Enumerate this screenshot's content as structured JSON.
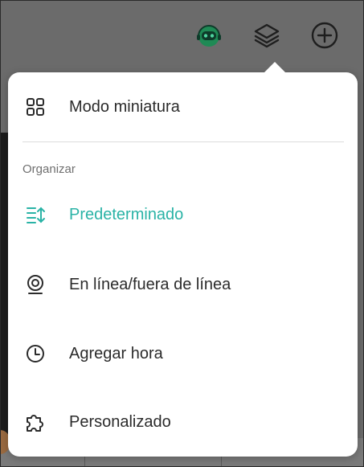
{
  "colors": {
    "accent": "#2ab3a6",
    "text": "#2b2b2b",
    "muted": "#6f6f6f",
    "robot_green": "#1f8a55"
  },
  "toolbar": {
    "icons": [
      "assistant-robot-icon",
      "layers-icon",
      "add-circle-icon"
    ]
  },
  "menu": {
    "thumbnail_mode": {
      "label": "Modo miniatura",
      "icon": "grid-icon"
    },
    "section_label": "Organizar",
    "items": [
      {
        "label": "Predeterminado",
        "icon": "sort-icon",
        "selected": true
      },
      {
        "label": "En línea/fuera de línea",
        "icon": "online-status-icon",
        "selected": false
      },
      {
        "label": "Agregar hora",
        "icon": "clock-icon",
        "selected": false
      },
      {
        "label": "Personalizado",
        "icon": "puzzle-icon",
        "selected": false
      }
    ]
  }
}
